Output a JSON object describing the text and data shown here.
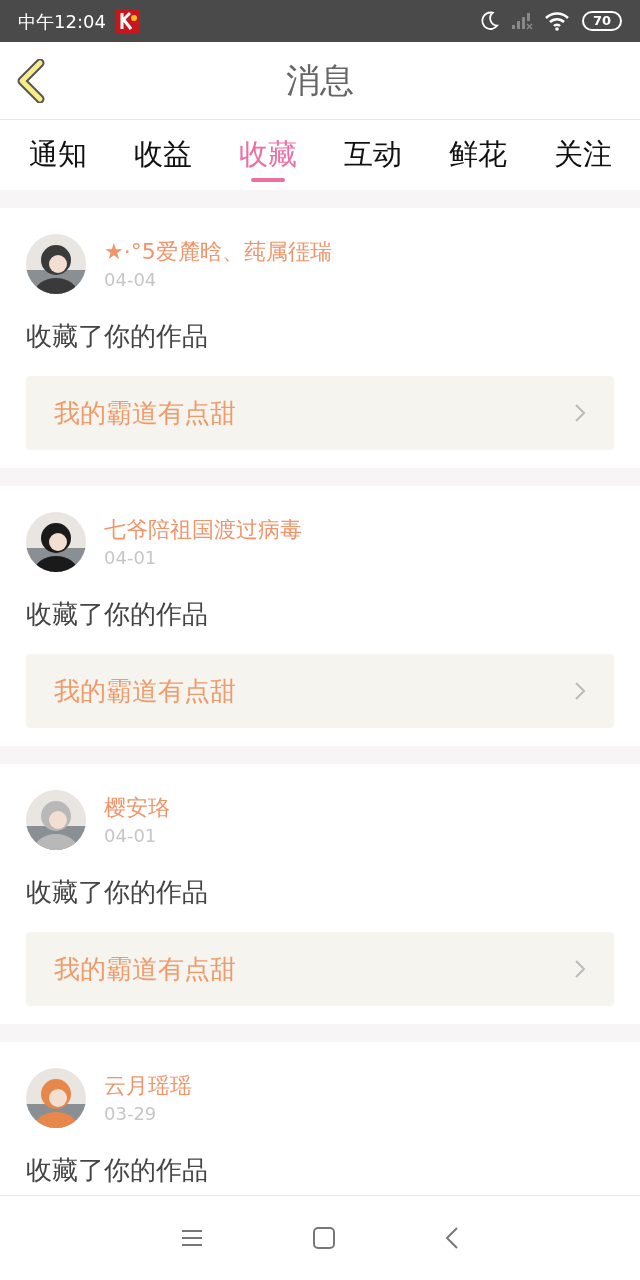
{
  "status_bar": {
    "time": "中午12:04",
    "battery": "70"
  },
  "header": {
    "title": "消息"
  },
  "tabs": [
    {
      "label": "通知",
      "selected": false
    },
    {
      "label": "收益",
      "selected": false
    },
    {
      "label": "收藏",
      "selected": true
    },
    {
      "label": "互动",
      "selected": false
    },
    {
      "label": "鲜花",
      "selected": false
    },
    {
      "label": "关注",
      "selected": false
    }
  ],
  "messages": [
    {
      "user": "★·°5爱麓晗、莼属徰瑞",
      "date": "04-04",
      "action": "收藏了你的作品",
      "work": "我的霸道有点甜"
    },
    {
      "user": "七爷陪祖国渡过病毒",
      "date": "04-01",
      "action": "收藏了你的作品",
      "work": "我的霸道有点甜"
    },
    {
      "user": "樱安珞",
      "date": "04-01",
      "action": "收藏了你的作品",
      "work": "我的霸道有点甜"
    },
    {
      "user": "云月瑶瑶",
      "date": "03-29",
      "action": "收藏了你的作品"
    }
  ]
}
